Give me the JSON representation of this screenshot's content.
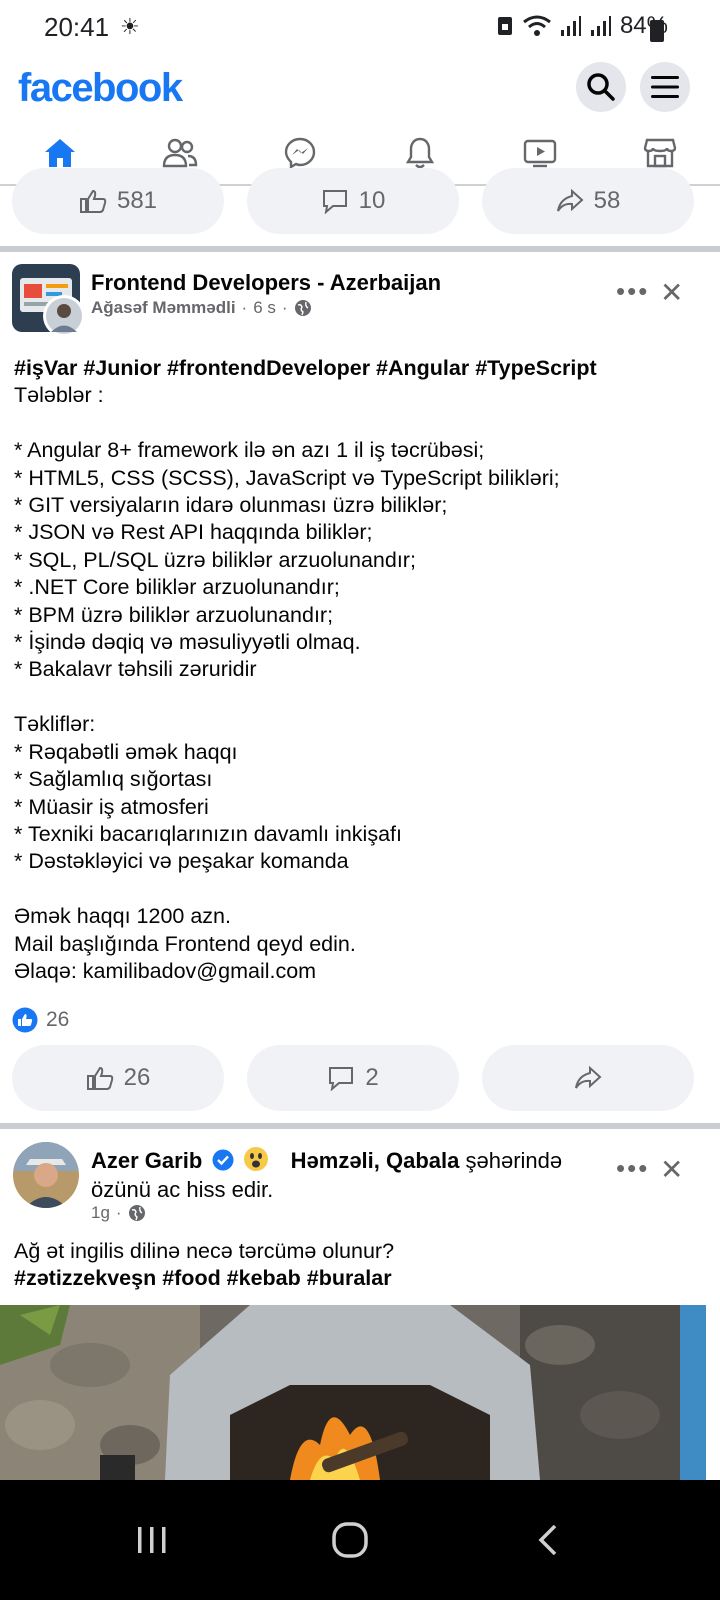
{
  "status": {
    "time": "20:41",
    "battery": "84%"
  },
  "header": {
    "logo": "facebook"
  },
  "tabs": [
    "home",
    "friends",
    "messenger",
    "notifications",
    "watch",
    "marketplace"
  ],
  "prev_post": {
    "likes": "581",
    "comments": "10",
    "shares": "58"
  },
  "post1": {
    "page": "Frontend Developers - Azerbaijan",
    "author": "Ağasəf Məmmədli",
    "time": "6 s",
    "hashtags": "#işVar #Junior #frontendDeveloper #Angular #TypeScript",
    "body": "Tələblər :\n\n* Angular 8+ framework ilə ən azı 1 il iş təcrübəsi;\n* HTML5, CSS (SCSS), JavaScript və TypeScript bilikləri;\n* GIT versiyaların idarə olunması üzrə biliklər;\n* JSON və Rest API haqqında biliklər;\n* SQL, PL/SQL üzrə biliklər arzuolunandır;\n* .NET Core biliklər arzuolunandır;\n* BPM üzrə biliklər arzuolunandır;\n* İşində dəqiq və məsuliyyətli olmaq.\n* Bakalavr təhsili zəruridir\n\nTəkliflər:\n* Rəqabətli əmək haqqı\n* Sağlamlıq sığortası\n* Müasir iş atmosferi\n* Texniki bacarıqlarınızın davamlı inkişafı\n* Dəstəkləyici və peşakar komanda\n\nƏmək haqqı 1200 azn.\nMail başlığında Frontend qeyd edin.\nƏlaqə: kamilibadov@gmail.com",
    "reaction_count": "26",
    "likes": "26",
    "comments": "2"
  },
  "post2": {
    "author": "Azer Garib",
    "feeling_place": "Həmzəli, Qabala",
    "feeling_mid": " şəhərində",
    "feeling_rest": "özünü ac hiss edir.",
    "time": "1g",
    "text": "Ağ ət ingilis dilinə necə tərcümə olunur?",
    "hashtags": "#zətizzekveşn #food #kebab #buralar"
  },
  "colors": {
    "brand": "#1877f2",
    "muted": "#65676b",
    "button_bg": "#f0f2f5"
  }
}
